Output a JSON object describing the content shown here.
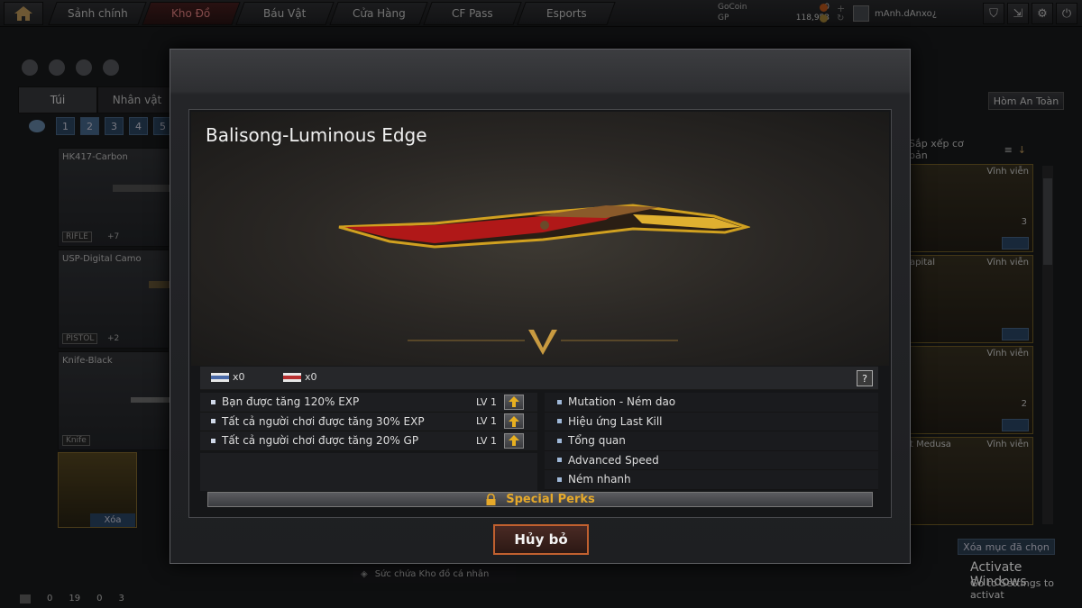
{
  "topbar": {
    "tabs": [
      "Sảnh chính",
      "Kho Đồ",
      "Báu Vật",
      "Cửa Hàng",
      "CF Pass",
      "Esports"
    ],
    "active_tab": "Kho Đồ",
    "gocoin_label": "GoCoin",
    "gocoin_value": "0",
    "gp_label": "GP",
    "gp_value": "118,953",
    "username": "mAnh.dAnxo¿"
  },
  "background": {
    "inv_tabs": [
      "Túi",
      "Nhân vật"
    ],
    "pages": [
      "1",
      "2",
      "3",
      "4",
      "5"
    ],
    "active_page": "2",
    "items": [
      {
        "name": "HK417-Carbon",
        "tag": "RIFLE",
        "count": "+7"
      },
      {
        "name": "USP-Digital Camo",
        "tag": "PISTOL",
        "count": "+2"
      },
      {
        "name": "Knife-Black",
        "tag": "Knife",
        "count": ""
      }
    ],
    "slot_delete": "Xóa",
    "safe_button": "Hòm An Toàn",
    "sort_label": "Sắp xếp cơ bản",
    "right_cards": [
      {
        "name": "",
        "perm": "Vĩnh viễn",
        "num": "3"
      },
      {
        "name": "apital",
        "perm": "Vĩnh viễn",
        "num": ""
      },
      {
        "name": "",
        "perm": "Vĩnh viễn",
        "num": "2"
      },
      {
        "name": "t Medusa",
        "perm": "Vĩnh viễn",
        "num": ""
      }
    ],
    "delete_selected": "Xóa mục đã chọn",
    "capacity_label": "Sức chứa Kho đồ cá nhân",
    "bottom_counts": [
      "0",
      "19",
      "0",
      "3"
    ],
    "watermark_title": "Activate Windows",
    "watermark_sub": "Go to Settings to activat"
  },
  "modal": {
    "weapon_name": "Balisong-Luminous Edge",
    "flag1_count": "x0",
    "flag2_count": "x0",
    "help": "?",
    "perks_left": [
      {
        "text": "Bạn được tăng 120%  EXP",
        "level": "LV 1"
      },
      {
        "text": "Tất cả người chơi được tăng 30% EXP",
        "level": "LV 1"
      },
      {
        "text": "Tất cả người chơi được tăng 20% GP",
        "level": "LV 1"
      }
    ],
    "perks_right": [
      "Mutation - Ném dao",
      "Hiệu ứng Last Kill",
      "Tổng quan",
      "Advanced Speed",
      "Ném nhanh"
    ],
    "special_perks": "Special Perks",
    "cancel": "Hủy bỏ"
  },
  "colors": {
    "accent_gold": "#e6a92a",
    "cancel_border": "#c0602f",
    "active_tab": "#e88888"
  }
}
